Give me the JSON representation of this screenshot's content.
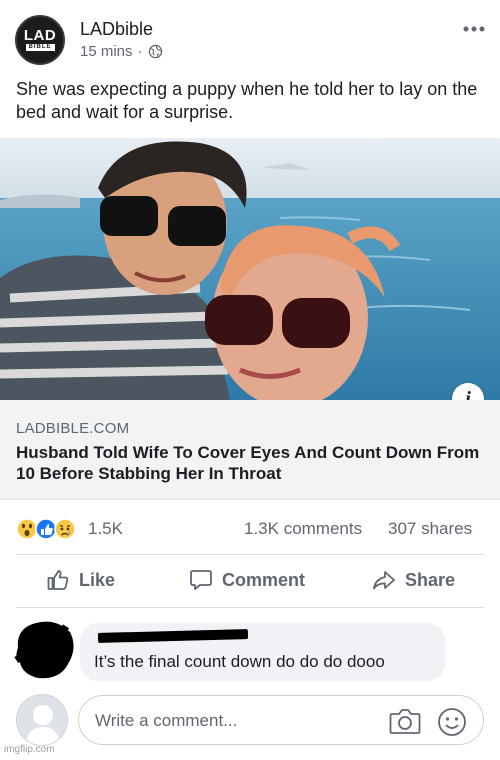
{
  "post": {
    "page_name": "LADbible",
    "page_logo_text_top": "LAD",
    "page_logo_text_bottom": "BIBLE",
    "time": "15 mins",
    "separator": "·",
    "text": "She was expecting a puppy when he told her to lay on the bed and wait for a surprise.",
    "more_icon": "more-horizontal-icon",
    "privacy_icon": "globe-icon"
  },
  "link": {
    "domain": "LADBIBLE.COM",
    "title": "Husband Told Wife To Cover Eyes And Count Down From 10 Before Stabbing Her In Throat",
    "info_label": "i"
  },
  "stats": {
    "reaction_icons": [
      "wow-reaction-icon",
      "like-reaction-icon",
      "sad-reaction-icon"
    ],
    "reaction_count": "1.5K",
    "comments": "1.3K comments",
    "shares": "307 shares"
  },
  "actions": {
    "like": "Like",
    "comment": "Comment",
    "share": "Share"
  },
  "comment": {
    "text": "It’s the final count down do do do dooo"
  },
  "composer": {
    "placeholder": "Write a comment...",
    "camera_icon": "camera-icon",
    "emoji_icon": "emoji-icon"
  },
  "watermark": "imgflip.com",
  "colors": {
    "secondary_text": "#606770",
    "preview_bg": "#f2f3f5",
    "like_blue": "#1877f2",
    "reaction_yellow": "#f7c843"
  }
}
